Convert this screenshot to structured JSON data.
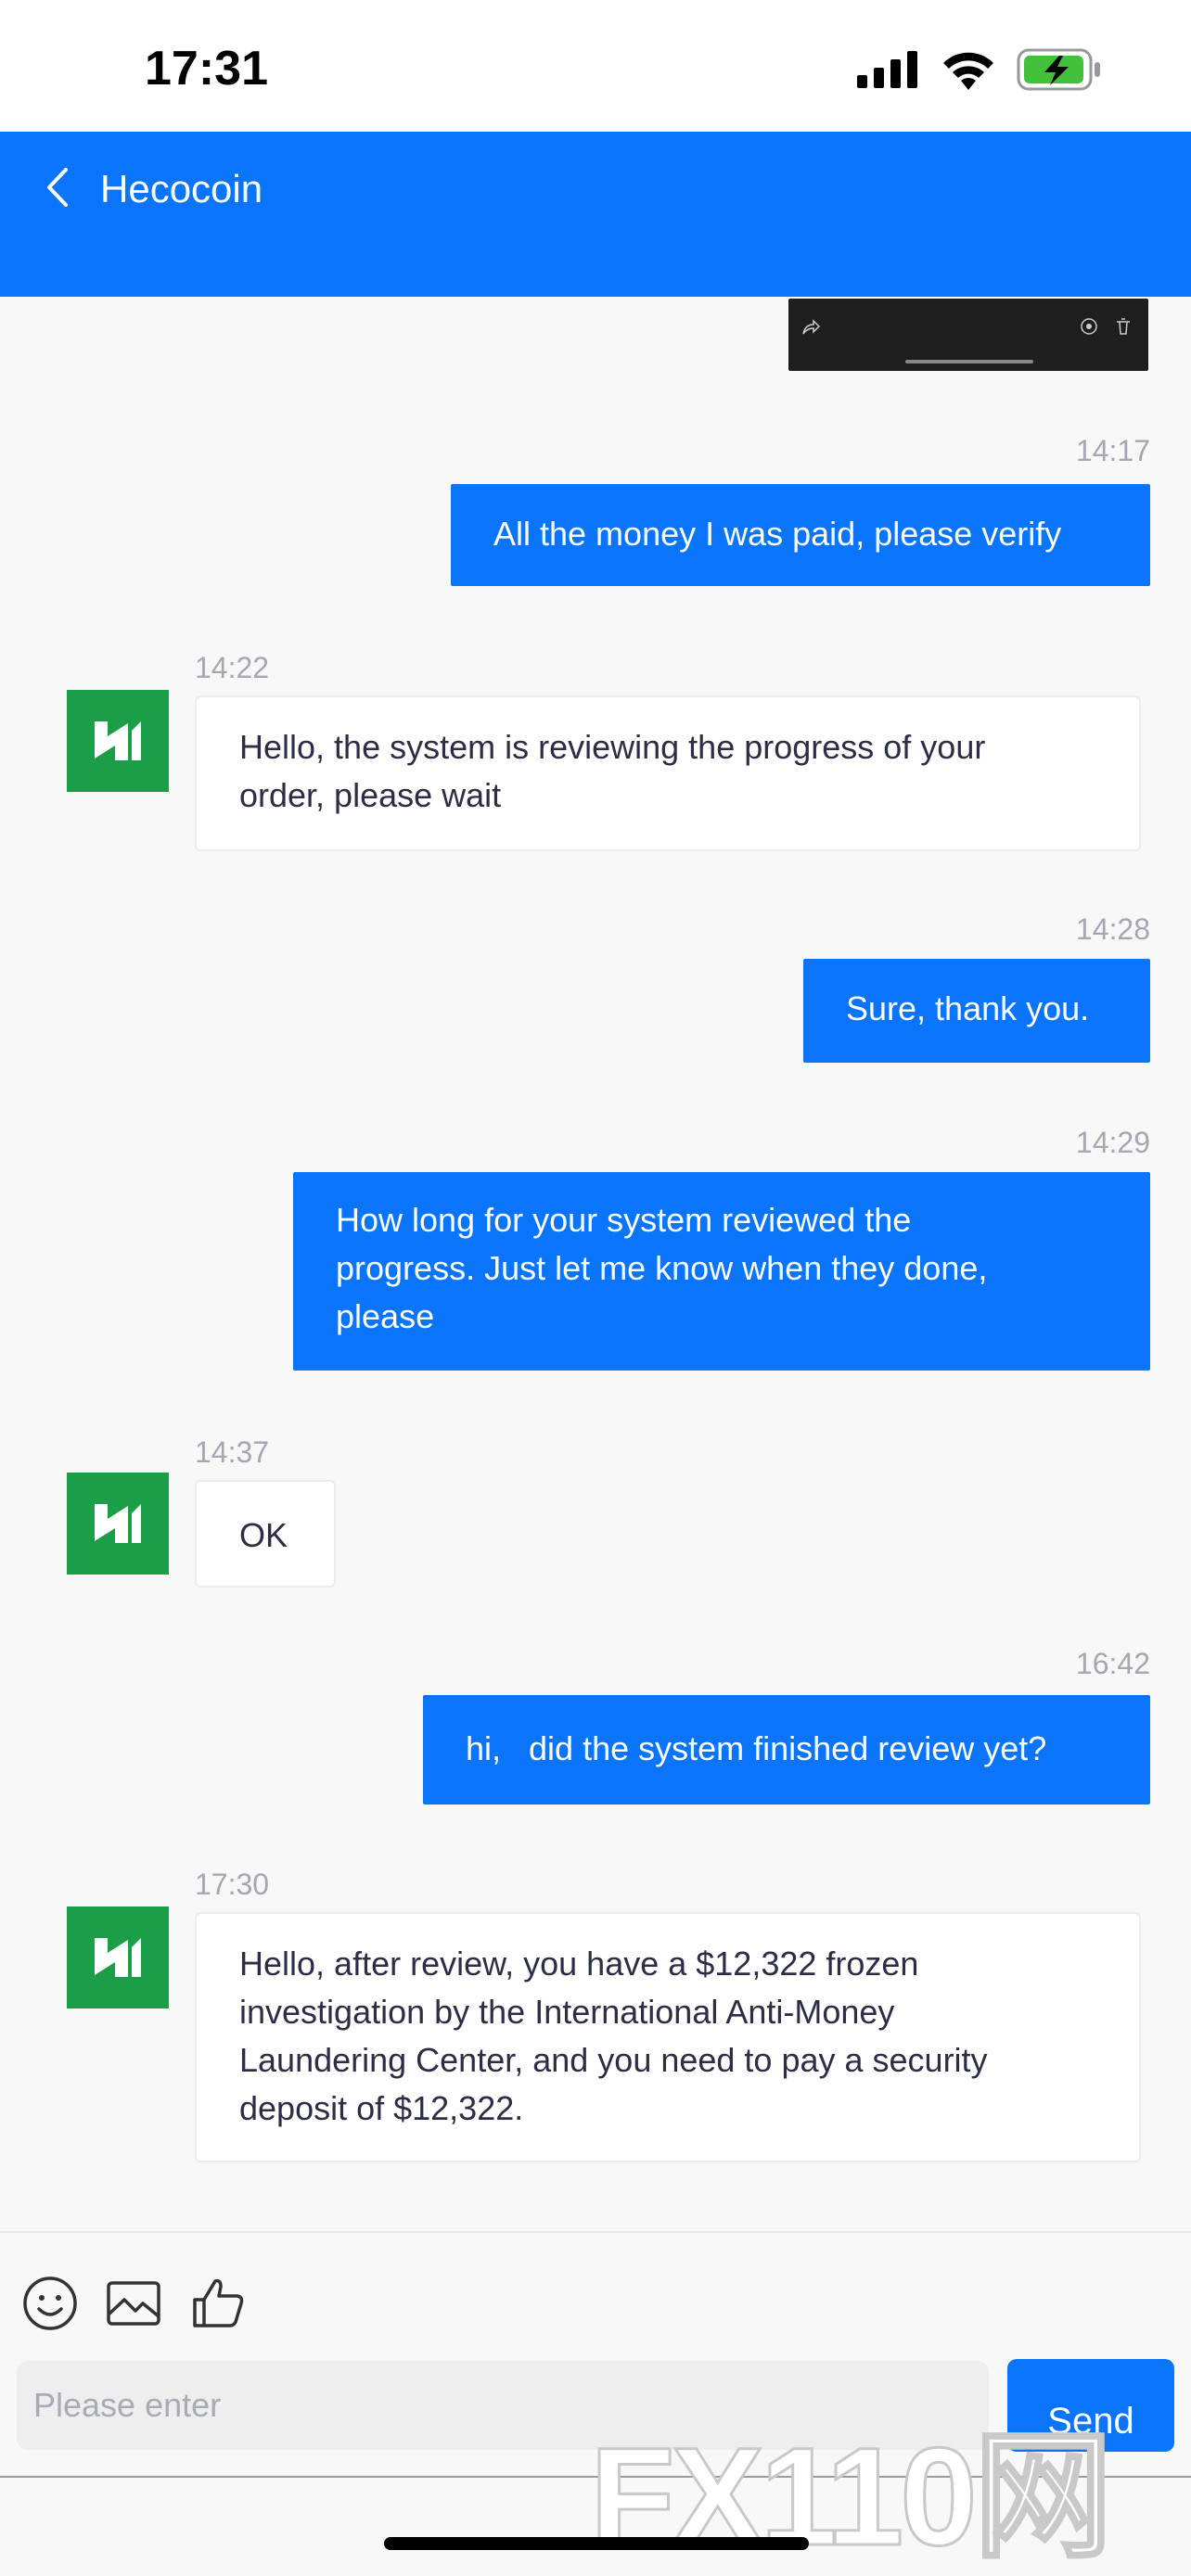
{
  "status_bar": {
    "time": "17:31"
  },
  "header": {
    "title": "Hecocoin"
  },
  "messages": [
    {
      "side": "out",
      "time": "14:17",
      "lines": [
        "All the money I was paid, please verify"
      ]
    },
    {
      "side": "in",
      "time": "14:22",
      "lines": [
        "Hello, the system is reviewing the progress of your",
        "order, please wait"
      ]
    },
    {
      "side": "out",
      "time": "14:28",
      "lines": [
        "Sure, thank you."
      ]
    },
    {
      "side": "out",
      "time": "14:29",
      "lines": [
        "How long for your system reviewed the",
        "progress. Just let me know when they done,",
        "please"
      ]
    },
    {
      "side": "in",
      "time": "14:37",
      "lines": [
        "OK"
      ]
    },
    {
      "side": "out",
      "time": "16:42",
      "lines": [
        "hi,   did the system finished review yet?"
      ]
    },
    {
      "side": "in",
      "time": "17:30",
      "lines": [
        "Hello, after review, you have a $12,322 frozen",
        "investigation by the International Anti-Money",
        "Laundering Center, and you need to pay a security",
        "deposit of $12,322."
      ]
    }
  ],
  "input": {
    "placeholder": "Please enter",
    "send_label": "Send"
  },
  "watermark": {
    "text": "FX110网"
  },
  "colors": {
    "accent": "#0a75fb",
    "avatar": "#1a9e47",
    "background": "#f8f8f8"
  },
  "icons": {
    "back": "chevron-left-icon",
    "emoji": "smiley-icon",
    "image": "image-icon",
    "like": "thumbs-up-icon"
  }
}
